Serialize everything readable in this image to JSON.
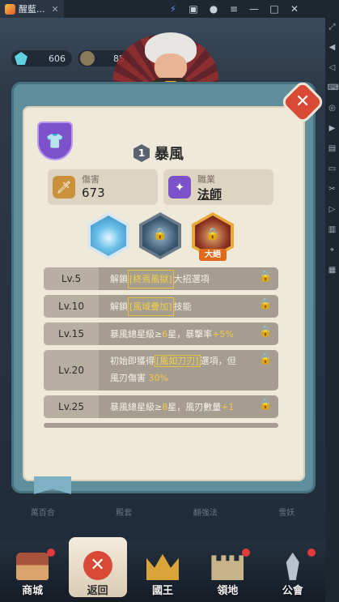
{
  "window": {
    "tab_title": "醒藍...",
    "close_glyph": "✕"
  },
  "resources": {
    "gems": "606",
    "coins": "85"
  },
  "dialog": {
    "badge_glyph": "👕",
    "skill_number": "1",
    "skill_name": "暴風",
    "stats": [
      {
        "label": "傷害",
        "value": "673",
        "icon": "sword-icon",
        "icon_glyph": "🗡"
      },
      {
        "label": "職業",
        "value": "法師",
        "icon": "staff-icon",
        "icon_glyph": "✦"
      }
    ],
    "skills": [
      {
        "name": "tornado-skill",
        "locked": false
      },
      {
        "name": "vortex-skill",
        "locked": true
      },
      {
        "name": "ultimate-skill",
        "locked": true,
        "tag": "大絕"
      }
    ],
    "lock_glyph": "🔒",
    "close_glyph": "✕",
    "levels": [
      {
        "level": "Lv.5",
        "parts": [
          "解鎖",
          "[終焉風獄]",
          "大招選項"
        ]
      },
      {
        "level": "Lv.10",
        "parts": [
          "解鎖",
          "[風域疊加]",
          "技能"
        ]
      },
      {
        "level": "Lv.15",
        "parts": [
          "暴風總星級≥",
          "6",
          "星，暴擊率",
          "+5%"
        ]
      },
      {
        "level": "Lv.20",
        "line1": [
          "初始即獲得",
          "[風如刀刃]",
          "選項，但"
        ],
        "line2": [
          "風刃傷害",
          "30%"
        ]
      },
      {
        "level": "Lv.25",
        "parts": [
          "暴風總星級≥",
          "8",
          "星，風刃數量",
          "+1"
        ]
      }
    ]
  },
  "under_labels": [
    "萬百合",
    "殿套",
    "翻強法",
    "雪妖"
  ],
  "bottom_nav": [
    {
      "label": "商城",
      "badge": true
    },
    {
      "label": "返回",
      "active": true,
      "glyph": "✕"
    },
    {
      "label": "國王",
      "badge": false
    },
    {
      "label": "領地",
      "badge": true
    },
    {
      "label": "公會",
      "badge": true
    }
  ],
  "colors": {
    "accent_red": "#d94a36",
    "highlight_yellow": "#f3d24a",
    "panel": "#efe9da",
    "frame": "#5f8f9c",
    "badge_purple": "#7b52c9"
  }
}
